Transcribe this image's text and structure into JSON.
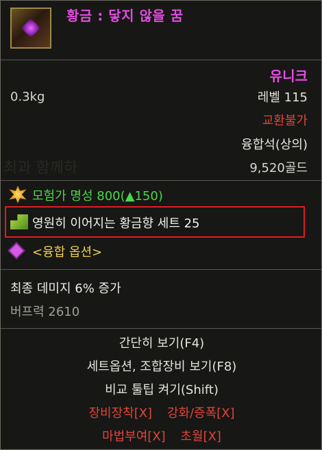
{
  "item": {
    "name": "황금 : 닿지 않을 꿈",
    "icon": "item-armor-icon",
    "rarity": "유니크",
    "weight": "0.3kg",
    "level": "레벨 115",
    "trade": "교환불가",
    "equip_type": "융합석(상의)",
    "price": "9,520골드"
  },
  "background_text": "최과 함께하",
  "fame": {
    "icon": "fame-star-icon",
    "text": "모험가 명성 800(▲150)"
  },
  "set": {
    "icon": "set-item-icon",
    "text": "영원히 이어지는 황금향 세트 25",
    "highlight_color": "#e21b24"
  },
  "fusion": {
    "icon": "diamond-icon",
    "label": "<융합 옵션>"
  },
  "stats": [
    {
      "text": "최종 데미지 6% 증가"
    },
    {
      "text": "버프력 2610"
    }
  ],
  "actions": {
    "quick_view": "간단히 보기(F4)",
    "set_options": "세트옵션, 조합장비 보기(F8)",
    "compare": "비교 툴팁 켜기(Shift)",
    "equip": "장비장착[X]",
    "enhance": "강화/증폭[X]",
    "enchant": "마법부여[X]",
    "transcend": "초월[X]"
  },
  "colors": {
    "rarity_unique": "#e94ce8",
    "untradeable": "#e0453c",
    "fame_green": "#4cd64c",
    "fusion_gold": "#f0d04a"
  }
}
